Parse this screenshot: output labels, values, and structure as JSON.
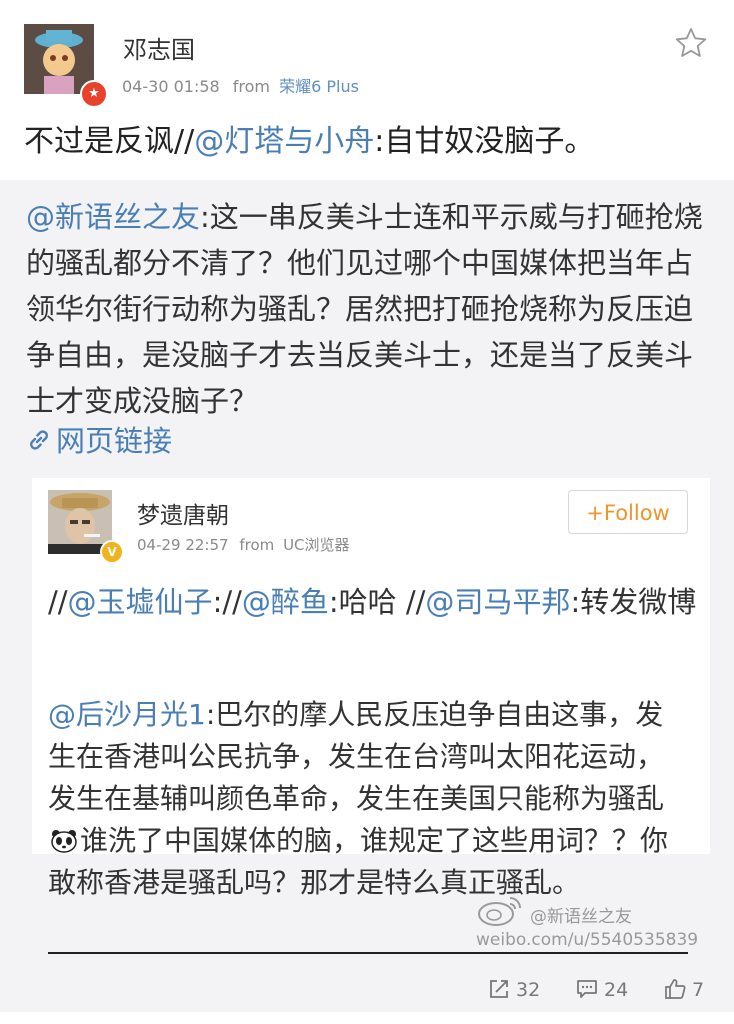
{
  "post": {
    "username": "邓志国",
    "timestamp": "04-30 01:58",
    "from_label": "from",
    "source": "荣耀6 Plus",
    "text_prefix": "不过是反讽//",
    "mention": "@灯塔与小舟",
    "text_suffix": ":自甘奴没脑子。"
  },
  "quoted": {
    "author": "@新语丝之友",
    "text": ":这一串反美斗士连和平示威与打砸抢烧的骚乱都分不清了？他们见过哪个中国媒体把当年占领华尔街行动称为骚乱？居然把打砸抢烧称为反压迫争自由，是没脑子才去当反美斗士，还是当了反美斗士才变成没脑子？",
    "web_link": "网页链接"
  },
  "card": {
    "username": "梦遗唐朝",
    "timestamp": "04-29 22:57",
    "from_label": "from",
    "source": "UC浏览器",
    "follow_label": "Follow",
    "text": {
      "p1": "//",
      "m1": "@玉墟仙子",
      "p2": "://",
      "m2": "@醉鱼",
      "p3": ":哈哈 //",
      "m3": "@司马平邦",
      "p4": ":转发微博"
    }
  },
  "reply": {
    "author": "@后沙月光1",
    "text_a": ":巴尔的摩人民反压迫争自由这事，发生在香港叫公民抗争，发生在台湾叫太阳花运动，发生在基辅叫颜色革命，发生在美国只能称为骚乱",
    "text_b": "谁洗了中国媒体的脑，谁规定了这些用词？？你敢称香港是骚乱吗？那才是特么真正骚乱。"
  },
  "watermark": {
    "handle": "@新语丝之友",
    "url": "weibo.com/u/5540535839"
  },
  "footer": {
    "reposts": "32",
    "comments": "24",
    "likes": "7"
  },
  "colors": {
    "link": "#4a7fb5",
    "follow": "#f0952c",
    "verified_red": "#e8412c",
    "verified_yellow": "#f1b31b",
    "quote_bg": "#f3f3f5"
  },
  "icons": [
    "star-icon",
    "link-icon",
    "panda-emoji-icon",
    "repost-icon",
    "comment-icon",
    "like-icon",
    "weibo-logo"
  ]
}
